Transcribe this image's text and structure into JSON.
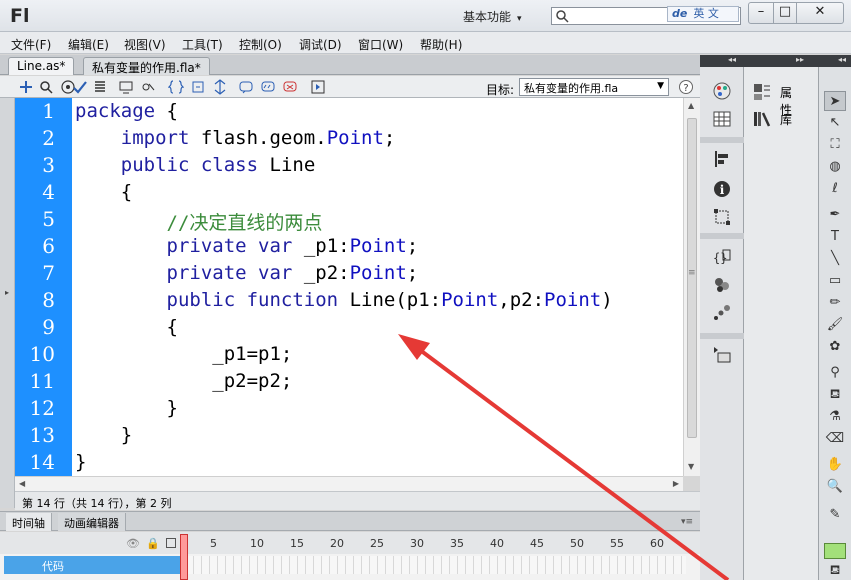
{
  "app": {
    "logo": "Fl",
    "workspace": "基本功能",
    "ime_text": "英 文",
    "ime_mark": "de"
  },
  "menu": [
    "文件(F)",
    "编辑(E)",
    "视图(V)",
    "工具(T)",
    "控制(O)",
    "调试(D)",
    "窗口(W)",
    "帮助(H)"
  ],
  "doc_tabs": [
    "Line.as*",
    "私有变量的作用.fla*"
  ],
  "toolbar": {
    "target_label": "目标:",
    "target_value": "私有变量的作用.fla"
  },
  "code": {
    "line_numbers": [
      "1",
      "2",
      "3",
      "4",
      "5",
      "6",
      "7",
      "8",
      "9",
      "10",
      "11",
      "12",
      "13",
      "14"
    ],
    "lines": [
      "package {",
      "    import flash.geom.Point;",
      "    public class Line",
      "    {",
      "        //决定直线的两点",
      "        private var _p1:Point;",
      "        private var _p2:Point;",
      "        public function Line(p1:Point,p2:Point)",
      "        {",
      "            _p1=p1;",
      "            _p2=p2;",
      "        }",
      "    }",
      "}"
    ]
  },
  "status": "第 14 行（共 14 行），第 2 列",
  "timeline": {
    "tabs": [
      "时间轴",
      "动画编辑器"
    ],
    "ruler": [
      "1",
      "5",
      "10",
      "15",
      "20",
      "25",
      "30",
      "35",
      "40",
      "45",
      "50",
      "55",
      "60"
    ],
    "layer_name": "代码"
  },
  "panels": {
    "properties": "属性",
    "library": "库"
  },
  "colors": {
    "gutter": "#1e90ff",
    "keyword": "#2020a0",
    "comment": "#3c8c3c",
    "arrow": "#e53935"
  }
}
